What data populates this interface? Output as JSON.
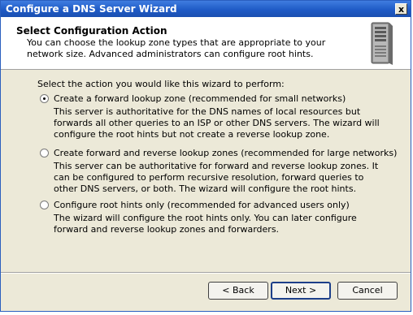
{
  "window": {
    "title": "Configure a DNS Server Wizard",
    "close_glyph": "x"
  },
  "header": {
    "title": "Select Configuration Action",
    "subtitle": "You can choose the lookup zone types that are appropriate to your network size. Advanced administrators can configure root hints.",
    "icon": "server-icon"
  },
  "prompt": "Select the action you would like this wizard to perform:",
  "options": [
    {
      "label": "Create a forward lookup zone (recommended for small networks)",
      "description": "This server is authoritative for the DNS names of local resources but forwards all other queries to an ISP or other DNS servers. The wizard will configure the root hints but not create a reverse lookup zone.",
      "selected": true
    },
    {
      "label": "Create forward and reverse lookup zones (recommended for large networks)",
      "description": "This server can be authoritative for forward and reverse lookup zones. It can be configured to perform recursive resolution, forward queries to other DNS servers, or both. The wizard will configure the root hints.",
      "selected": false
    },
    {
      "label": "Configure root hints only (recommended for advanced users only)",
      "description": "The wizard will configure the root hints only. You can later configure forward and reverse lookup zones and forwarders.",
      "selected": false
    }
  ],
  "buttons": {
    "back": "< Back",
    "next": "Next >",
    "cancel": "Cancel"
  }
}
